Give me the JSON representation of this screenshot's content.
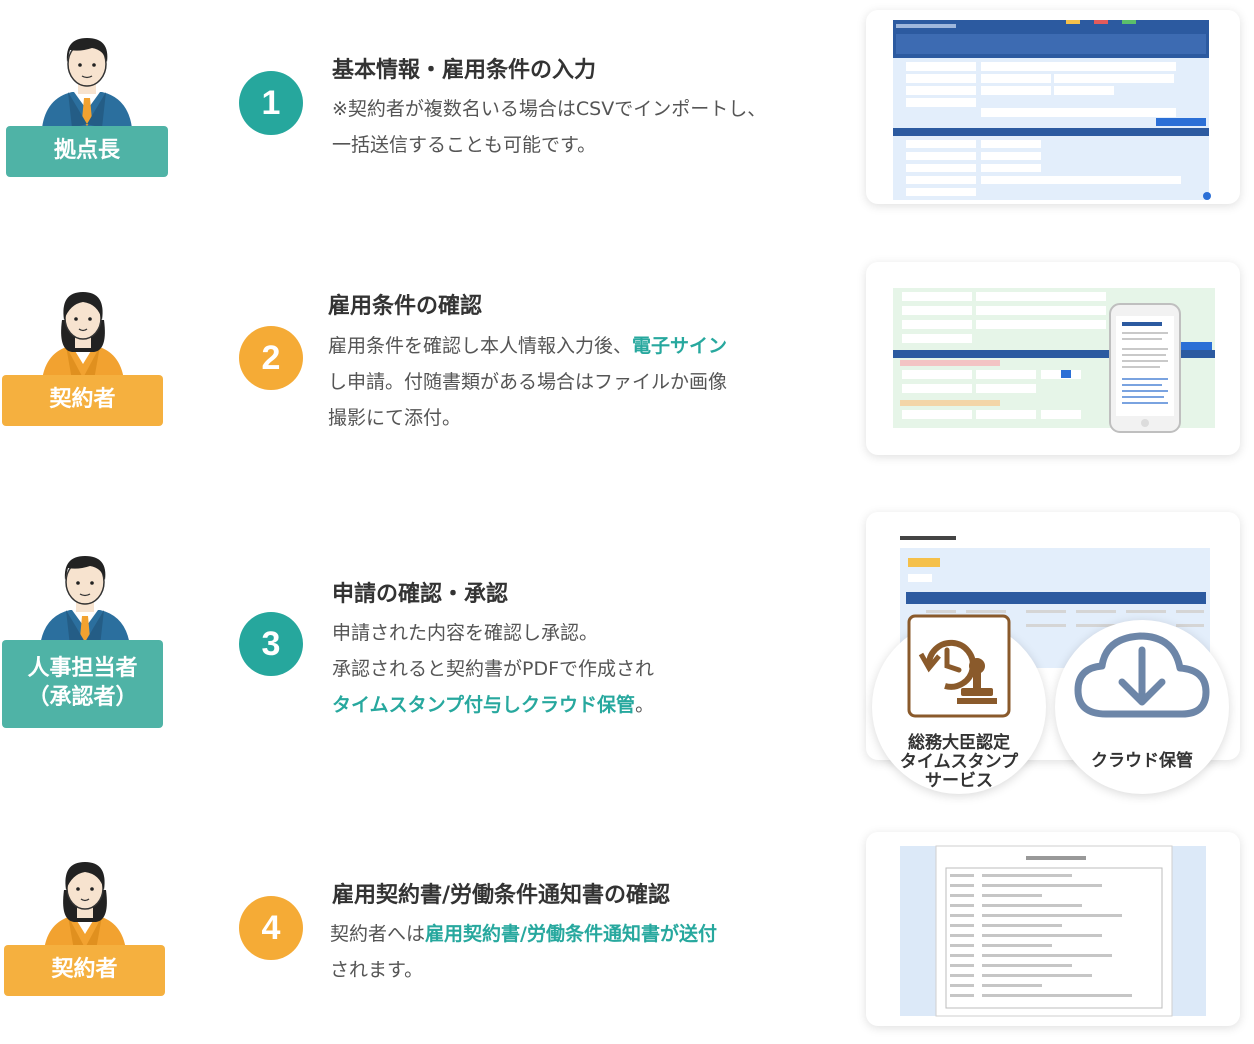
{
  "steps": [
    {
      "role": "拠点長",
      "number": "1",
      "title": "基本情報・雇用条件の入力",
      "desc_line1": "※契約者が複数名いる場合はCSVでインポートし、",
      "desc_line2": "一括送信することも可能です。"
    },
    {
      "role": "契約者",
      "number": "2",
      "title": "雇用条件の確認",
      "desc_line1_pre": "雇用条件を確認し本人情報入力後、",
      "desc_line1_hl": "電子サイン",
      "desc_line2": "し申請。付随書類がある場合はファイルか画像",
      "desc_line3": "撮影にて添付。"
    },
    {
      "role_line1": "人事担当者",
      "role_line2": "（承認者）",
      "number": "3",
      "title": "申請の確認・承認",
      "desc_line1": "申請された内容を確認し承認。",
      "desc_line2": "承認されると契約書がPDFで作成され",
      "desc_line3_hl": "タイムスタンプ付与しクラウド保管",
      "desc_line3_post": "。",
      "timestamp_label_1": "総務大臣認定",
      "timestamp_label_2": "タイムスタンプ",
      "timestamp_label_3": "サービス",
      "cloud_label": "クラウド保管"
    },
    {
      "role": "契約者",
      "number": "4",
      "title": "雇用契約書/労働条件通知書の確認",
      "desc_line1_pre": "契約者へは",
      "desc_line1_hl": "雇用契約書/労働条件通知書が送付",
      "desc_line2": "されます。"
    }
  ],
  "colors": {
    "teal": "#4fb3a6",
    "number_teal": "#26a79d",
    "orange": "#f5b03f",
    "highlight": "#27a89e"
  },
  "icons": [
    "man-avatar-icon",
    "woman-avatar-icon",
    "timestamp-stamp-icon",
    "cloud-download-icon"
  ]
}
